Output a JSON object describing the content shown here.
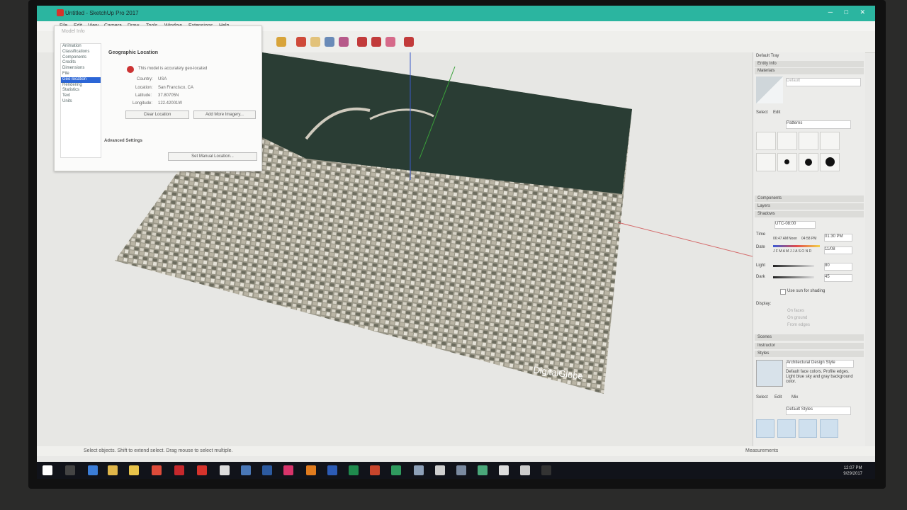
{
  "window": {
    "title": "Untitled - SketchUp Pro 2017"
  },
  "menu": [
    "File",
    "Edit",
    "View",
    "Camera",
    "Draw",
    "Tools",
    "Window",
    "Extensions",
    "Help"
  ],
  "model_info": {
    "title": "Model Info",
    "nav": [
      "Animation",
      "Classifications",
      "Components",
      "Credits",
      "Dimensions",
      "File",
      "Geo-location",
      "Rendering",
      "Statistics",
      "Text",
      "Units"
    ],
    "selected_nav": "Geo-location",
    "section_title": "Geographic Location",
    "status": "This model is accurately geo-located",
    "fields": [
      {
        "label": "Country:",
        "value": "USA"
      },
      {
        "label": "Location:",
        "value": "San Francisco, CA"
      },
      {
        "label": "Latitude:",
        "value": "37.80705N"
      },
      {
        "label": "Longitude:",
        "value": "122.42001W"
      }
    ],
    "clear_btn": "Clear Location",
    "add_btn": "Add More Imagery...",
    "advanced": "Advanced Settings",
    "manual_btn": "Set Manual Location..."
  },
  "viewport": {
    "watermark": "DigitalGlobe"
  },
  "tray": {
    "title": "Default Tray",
    "entity_info": "Entity Info",
    "materials": "Materials",
    "material_name": "Default",
    "tab_select": "Select",
    "tab_edit": "Edit",
    "library": "Patterns",
    "components": "Components",
    "layers": "Layers",
    "shadows": "Shadows",
    "utc": "UTC-08:00",
    "time_label": "Time",
    "time_am": "06:47 AM",
    "time_noon": "Noon",
    "time_pm": "04:58 PM",
    "time_value": "01:30 PM",
    "date_label": "Date",
    "months": "J F M A M J J A S O N D",
    "date_value": "11/08",
    "light_label": "Light",
    "light_value": "80",
    "dark_label": "Dark",
    "dark_value": "45",
    "use_sun": "Use sun for shading",
    "display": "Display:",
    "on_faces": "On faces",
    "on_ground": "On ground",
    "from_edges": "From edges",
    "scenes": "Scenes",
    "instructor": "Instructor",
    "styles": "Styles",
    "style_name": "Architectural Design Style",
    "style_desc": "Default face colors. Profile edges. Light blue sky and gray background color.",
    "styles_tab_select": "Select",
    "styles_tab_edit": "Edit",
    "styles_tab_mix": "Mix",
    "styles_library": "Default Styles"
  },
  "status_bar": {
    "hint": "Select objects. Shift to extend select. Drag mouse to select multiple.",
    "measurements": "Measurements"
  },
  "taskbar": {
    "time": "12:07 PM",
    "date": "9/29/2017"
  },
  "colors": {
    "titlebar": "#2bb5a0",
    "selection": "#2c66d6"
  }
}
